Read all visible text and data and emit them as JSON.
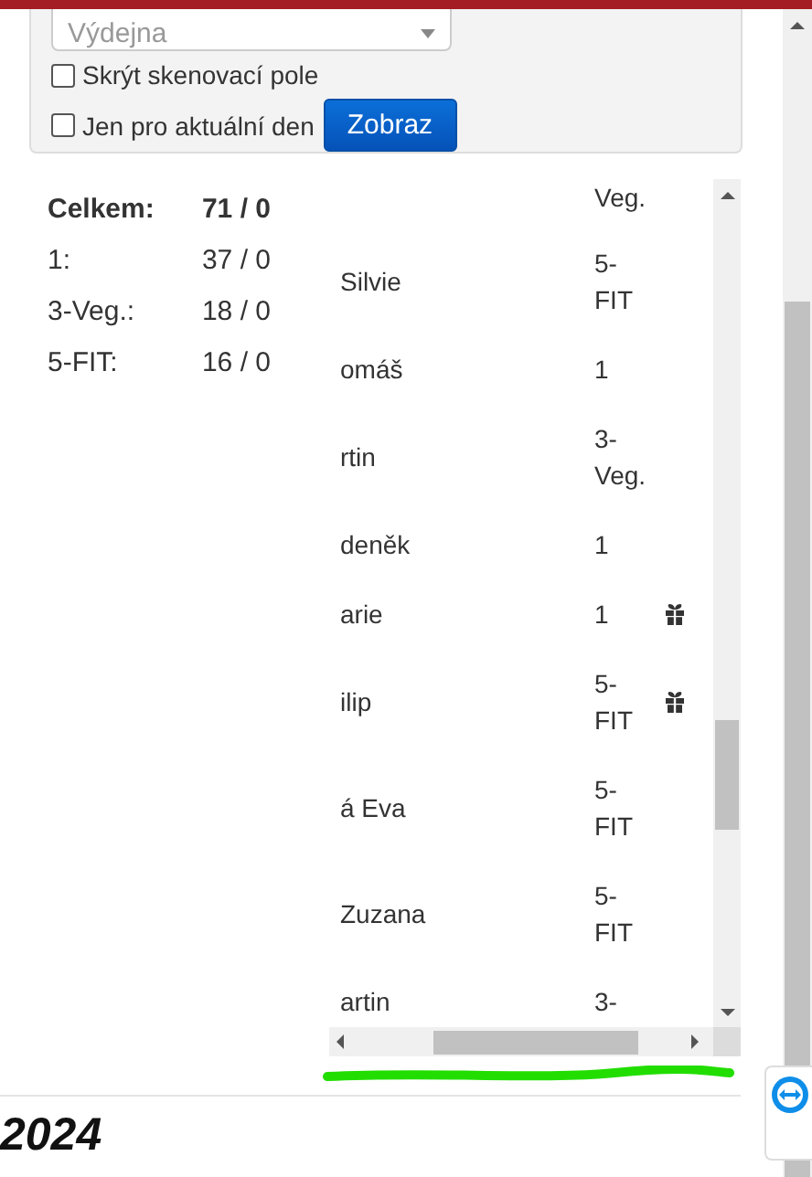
{
  "filter_panel": {
    "select": {
      "placeholder": "Výdejna"
    },
    "checkboxes": [
      {
        "label": "Skrýt skenovací pole",
        "checked": false
      },
      {
        "label": "Jen pro aktuální den",
        "checked": false
      }
    ],
    "button": "Zobraz"
  },
  "summary": [
    {
      "label": "Celkem:",
      "value": "71 / 0",
      "total": true
    },
    {
      "label": "1:",
      "value": "37 / 0",
      "total": false
    },
    {
      "label": "3-Veg.:",
      "value": "18 / 0",
      "total": false
    },
    {
      "label": "5-FIT:",
      "value": "16 / 0",
      "total": false
    }
  ],
  "table": {
    "rows": [
      {
        "meal": "Veg.",
        "gift": false
      },
      {
        "name": "Silvie",
        "meal": "5-FIT",
        "gift": false
      },
      {
        "name": "omáš",
        "meal": "1",
        "gift": false
      },
      {
        "name": "rtin",
        "meal": "3-Veg.",
        "gift": false
      },
      {
        "name": "deněk",
        "meal": "1",
        "gift": false
      },
      {
        "name": "arie",
        "meal": "1",
        "gift": true
      },
      {
        "name": "ilip",
        "meal": "5-FIT",
        "gift": true
      },
      {
        "name": "á Eva",
        "meal": "5-FIT",
        "gift": false
      },
      {
        "name": "Zuzana",
        "meal": "5-FIT",
        "gift": false
      },
      {
        "name": "artin",
        "meal": "3-",
        "gift": false
      }
    ]
  },
  "footer": {
    "heading": "2024"
  }
}
